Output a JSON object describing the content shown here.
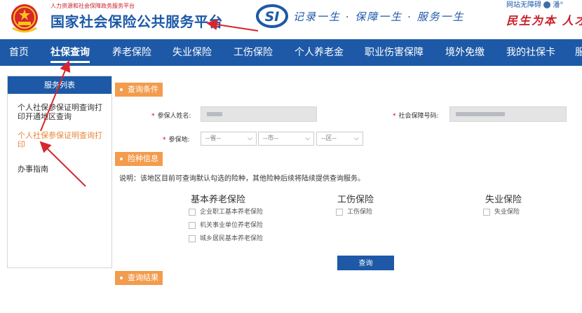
{
  "header": {
    "ministry": "人力资源和社会保障政务服务平台",
    "title": "国家社会保险公共服务平台",
    "si_mark": "SI",
    "slogan": "记录一生 · 保障一生 · 服务一生",
    "accessibility": "网站无障碍",
    "user": "潘°",
    "motto": "民生为本 人才",
    "emblem_icon": "national-emblem-icon",
    "colors": {
      "brand_blue": "#1d59a7",
      "brand_red": "#c8202a",
      "accent_orange": "#f39c4d"
    }
  },
  "nav": {
    "items": [
      {
        "label": "首页"
      },
      {
        "label": "社保查询",
        "active": true
      },
      {
        "label": "养老保险"
      },
      {
        "label": "失业保险"
      },
      {
        "label": "工伤保险"
      },
      {
        "label": "个人养老金"
      },
      {
        "label": "职业伤害保障"
      },
      {
        "label": "境外免缴"
      },
      {
        "label": "我的社保卡"
      },
      {
        "label": "服"
      }
    ]
  },
  "sidebar": {
    "title": "服务列表",
    "items": [
      {
        "label": "个人社保参保证明查询打印开通地区查询"
      },
      {
        "label": "个人社保参保证明查询打印",
        "active": true
      },
      {
        "label": "办事指南"
      }
    ]
  },
  "sections": {
    "query_conditions": "查询条件",
    "insurance_types": "险种信息",
    "query_results": "查询结果"
  },
  "form": {
    "name_label": "参保人姓名:",
    "ssn_label": "社会保障号码:",
    "region_label": "参保地:",
    "province_placeholder": "--省--",
    "city_placeholder": "--市--",
    "district_placeholder": "--区--"
  },
  "note": "说明：该地区目前可查询默认勾选的险种，其他险种后续将陆续提供查询服务。",
  "insurance": {
    "pension": {
      "title": "基本养老保险",
      "options": [
        "企业职工基本养老保险",
        "机关事业单位养老保险",
        "城乡居民基本养老保险"
      ]
    },
    "injury": {
      "title": "工伤保险",
      "options": [
        "工伤保险"
      ]
    },
    "unemployment": {
      "title": "失业保险",
      "options": [
        "失业保险"
      ]
    }
  },
  "query_button": "查询"
}
